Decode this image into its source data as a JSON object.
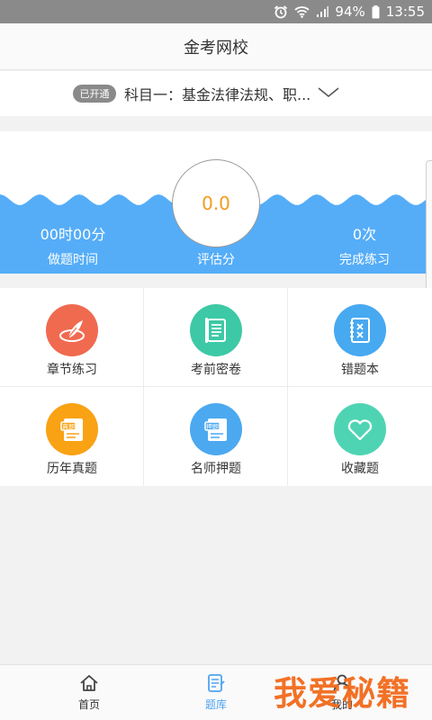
{
  "status_bar": {
    "battery": "94%",
    "time": "13:55"
  },
  "header": {
    "title": "金考网校"
  },
  "subject": {
    "badge": "已开通",
    "text": "科目一：基金法律法规、职..."
  },
  "score": {
    "study_time": {
      "value": "00时00分",
      "label": "做题时间"
    },
    "evaluation": {
      "value": "0.0",
      "label": "评估分"
    },
    "practice": {
      "value": "0次",
      "label": "完成练习"
    }
  },
  "menu": {
    "items": [
      {
        "label": "章节练习",
        "icon": "quill-icon",
        "color": "#f06a50"
      },
      {
        "label": "考前密卷",
        "icon": "scroll-icon",
        "color": "#3dc9a6"
      },
      {
        "label": "错题本",
        "icon": "notebook-icon",
        "color": "#47a9f0"
      },
      {
        "label": "历年真题",
        "icon": "exam-paper-icon",
        "color": "#f9a214"
      },
      {
        "label": "名师押题",
        "icon": "predict-paper-icon",
        "color": "#4ca9f0"
      },
      {
        "label": "收藏题",
        "icon": "heart-icon",
        "color": "#4fd4b3"
      }
    ]
  },
  "tabs": [
    {
      "label": "首页",
      "icon": "home-icon"
    },
    {
      "label": "题库",
      "icon": "question-bank-icon",
      "active": true
    },
    {
      "label": "我的",
      "icon": "profile-icon"
    }
  ],
  "watermark": "我爱秘籍",
  "colors": {
    "wave": "#55adf8",
    "accent": "#4fa3ef",
    "score": "#f39a1e"
  }
}
